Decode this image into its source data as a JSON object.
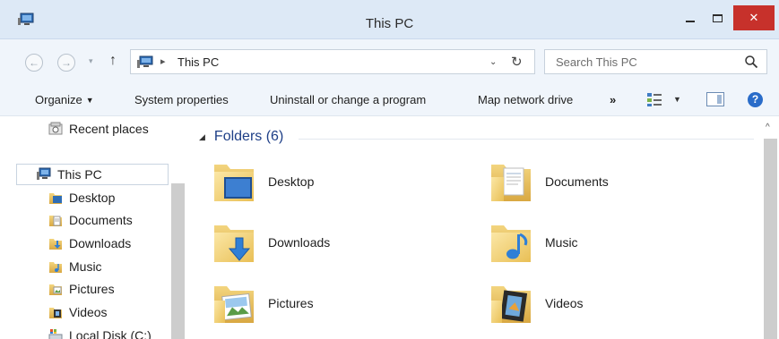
{
  "window": {
    "title": "This PC",
    "close_glyph": "✕"
  },
  "nav": {
    "back_glyph": "←",
    "forward_glyph": "→",
    "recent_glyph": "▾",
    "up_glyph": "↑"
  },
  "address": {
    "separator": "▸",
    "path": "This PC",
    "dropdown_glyph": "⌄",
    "refresh_glyph": "↻"
  },
  "search": {
    "placeholder": "Search This PC"
  },
  "toolbar": {
    "organize": "Organize",
    "system_properties": "System properties",
    "uninstall": "Uninstall or change a program",
    "map_network_drive": "Map network drive",
    "more": "»",
    "help": "?"
  },
  "sidebar": {
    "scroll_up": "^",
    "items": [
      {
        "label": "Recent places",
        "icon": "recent-places-icon"
      },
      {
        "label": "This PC",
        "icon": "this-pc-icon"
      },
      {
        "label": "Desktop",
        "icon": "desktop-icon"
      },
      {
        "label": "Documents",
        "icon": "documents-icon"
      },
      {
        "label": "Downloads",
        "icon": "downloads-icon"
      },
      {
        "label": "Music",
        "icon": "music-icon"
      },
      {
        "label": "Pictures",
        "icon": "pictures-icon"
      },
      {
        "label": "Videos",
        "icon": "videos-icon"
      },
      {
        "label": "Local Disk (C:)",
        "icon": "local-disk-icon"
      }
    ]
  },
  "main": {
    "group_title": "Folders (6)",
    "scroll_up": "^",
    "folders": [
      {
        "label": "Desktop",
        "icon": "desktop-folder-icon"
      },
      {
        "label": "Documents",
        "icon": "documents-folder-icon"
      },
      {
        "label": "Downloads",
        "icon": "downloads-folder-icon"
      },
      {
        "label": "Music",
        "icon": "music-folder-icon"
      },
      {
        "label": "Pictures",
        "icon": "pictures-folder-icon"
      },
      {
        "label": "Videos",
        "icon": "videos-folder-icon"
      }
    ]
  },
  "colors": {
    "title_bar": "#dde9f6",
    "close_button": "#c7312b",
    "group_header": "#1e3f87",
    "folder_yellow": "#f3d57f"
  }
}
